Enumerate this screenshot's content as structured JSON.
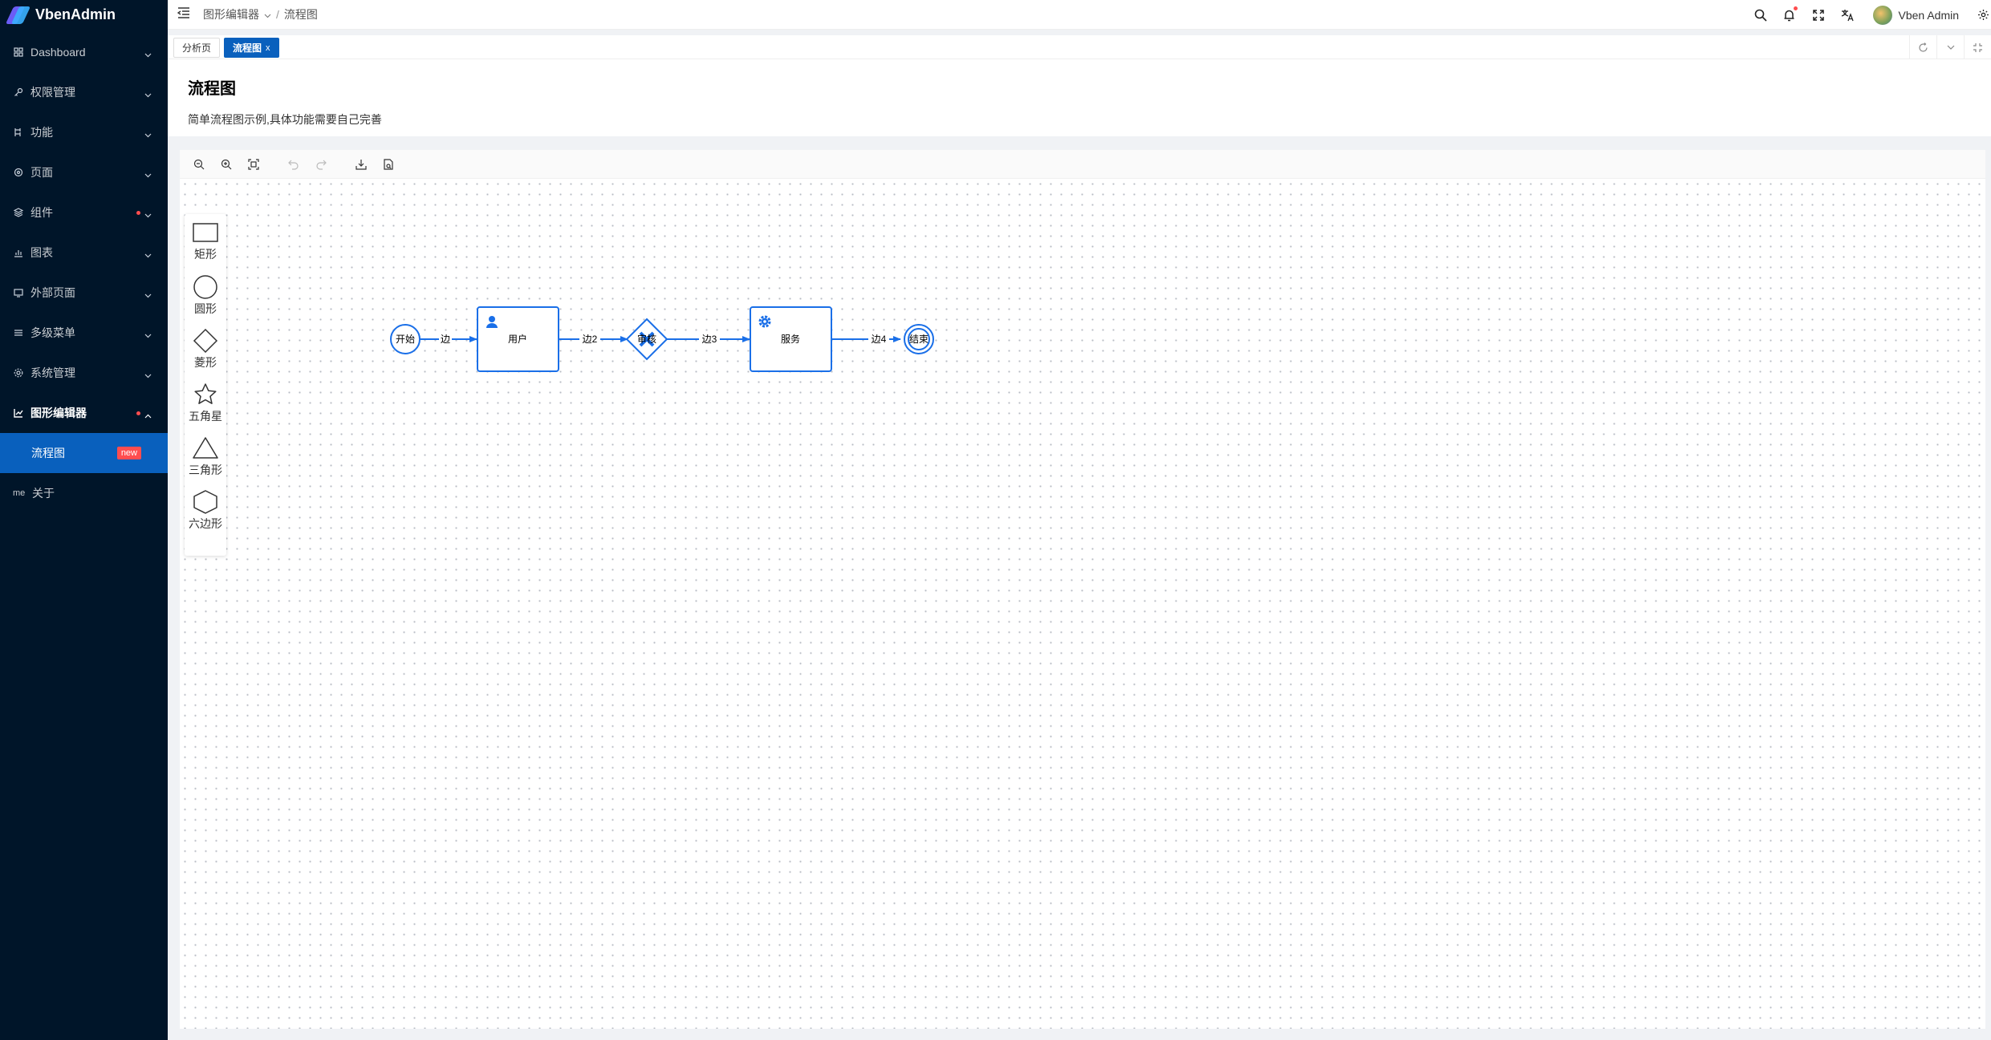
{
  "app": {
    "name": "VbenAdmin"
  },
  "sidebar": {
    "items": [
      {
        "label": "Dashboard",
        "icon": "dashboard-icon"
      },
      {
        "label": "权限管理",
        "icon": "key-icon"
      },
      {
        "label": "功能",
        "icon": "function-icon"
      },
      {
        "label": "页面",
        "icon": "page-icon"
      },
      {
        "label": "组件",
        "icon": "component-icon"
      },
      {
        "label": "图表",
        "icon": "chart-icon"
      },
      {
        "label": "外部页面",
        "icon": "monitor-icon"
      },
      {
        "label": "多级菜单",
        "icon": "list-icon"
      },
      {
        "label": "系统管理",
        "icon": "settings-icon"
      },
      {
        "label": "图形编辑器",
        "icon": "graph-icon"
      },
      {
        "label": "流程图",
        "badge": "new"
      },
      {
        "label": "关于",
        "prefix": "me"
      }
    ]
  },
  "breadcrumb": {
    "parent": "图形编辑器",
    "sep": "/",
    "current": "流程图"
  },
  "header": {
    "username": "Vben Admin"
  },
  "tabs": [
    {
      "label": "分析页"
    },
    {
      "label": "流程图",
      "close": "x"
    }
  ],
  "page": {
    "title": "流程图",
    "description": "简单流程图示例,具体功能需要自己完善"
  },
  "palette": [
    {
      "label": "矩形",
      "icon": "rect-icon"
    },
    {
      "label": "圆形",
      "icon": "circle-icon"
    },
    {
      "label": "菱形",
      "icon": "diamond-icon"
    },
    {
      "label": "五角星",
      "icon": "star-icon"
    },
    {
      "label": "三角形",
      "icon": "triangle-icon"
    },
    {
      "label": "六边形",
      "icon": "hexagon-icon"
    }
  ],
  "flow": {
    "nodes": {
      "start": "开始",
      "user": "用户",
      "gateway": "审核",
      "service": "服务",
      "end": "结束"
    },
    "edges": {
      "e1": "边",
      "e2": "边2",
      "e3": "边3",
      "e4": "边4"
    }
  },
  "colors": {
    "sidebar_bg": "#001529",
    "primary": "#0960bd",
    "flow_blue": "#1a6fe8",
    "badge_red": "#ff4d4f"
  }
}
